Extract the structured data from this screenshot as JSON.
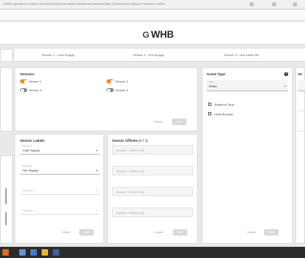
{
  "browser": {
    "url": "editors.gamebus-stack.com/hub/builder/template/dashboard/wizard/step-2/sensors/configure?session=active"
  },
  "app": {
    "logo": "WHB",
    "logo_mark": "G"
  },
  "steps": [
    "Sensor 1 : Cold Supply",
    "Sensor 2 : Hot Supply",
    "Sensor 3 : Not Used Set"
  ],
  "sensors": {
    "title": "Sensors",
    "items": [
      {
        "label": "Sensor 1",
        "on": true
      },
      {
        "label": "Sensor 2",
        "on": true
      },
      {
        "label": "Sensor 3",
        "on": false
      },
      {
        "label": "Sensor 4",
        "on": false
      }
    ],
    "cancel": "Cancel",
    "next": "Next"
  },
  "asset_type": {
    "title": "Asset Type",
    "help_icon": "help-circle-icon",
    "select_label": "Type",
    "select_value": "Boiler",
    "checkboxes": [
      "Buffered Tank",
      "Heat Booster"
    ]
  },
  "sensor_labels": {
    "title": "Sensor Labels",
    "fields": [
      {
        "small": "Sensor 1",
        "value": "Cold Supply",
        "disabled": false
      },
      {
        "small": "Sensor 2",
        "value": "Hot Supply",
        "disabled": false
      },
      {
        "small": "",
        "value": "Sensor 3",
        "disabled": true
      },
      {
        "small": "",
        "value": "Sensor 4",
        "disabled": true
      }
    ],
    "cancel": "Cancel",
    "next": "Next"
  },
  "sensor_offsets": {
    "title": "Sensor Offsets (+ / -)",
    "fields": [
      "Sensor 1 Offset (%)",
      "Sensor 2 Offset (%)",
      "Sensor 3 Offset (%)",
      "Sensor 4 Offset (%)"
    ],
    "cancel": "Cancel",
    "next": "Next"
  },
  "asset_footer": {
    "cancel": "Cancel",
    "next": "Next"
  },
  "right_panel": {
    "title": "Se"
  },
  "colors": {
    "accent": "#f08a24",
    "taskbar": "#2b2b2b"
  }
}
